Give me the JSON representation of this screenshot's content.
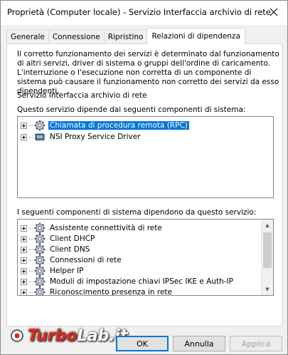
{
  "window": {
    "title": "Proprietà (Computer locale) - Servizio Interfaccia archivio di rete"
  },
  "tabs": [
    {
      "label": "Generale"
    },
    {
      "label": "Connessione"
    },
    {
      "label": "Ripristino"
    },
    {
      "label": "Relazioni di dipendenza"
    }
  ],
  "description": "Il corretto funzionamento dei servizi è determinato dal funzionamento di altri servizi, driver di sistema o gruppi dell'ordine di caricamento. L'interruzione o l'esecuzione non corretta di un componente di sistema può causare il funzionamento non corretto dei servizi da esso dipendenti.",
  "service_name": "Servizio Interfaccia archivio di rete",
  "depends_on": {
    "label": "Questo servizio dipende dai seguenti componenti di sistema:",
    "items": [
      {
        "label": "Chiamata di procedura remota (RPC)"
      },
      {
        "label": "NSI Proxy Service Driver"
      }
    ]
  },
  "dependents": {
    "label": "I seguenti componenti di sistema dipendono da questo servizio:",
    "items": [
      {
        "label": "Assistente connettività di rete"
      },
      {
        "label": "Client DHCP"
      },
      {
        "label": "Client DNS"
      },
      {
        "label": "Connessioni di rete"
      },
      {
        "label": "Helper IP"
      },
      {
        "label": "Moduli di impostazione chiavi IPSec IKE e Auth-IP"
      },
      {
        "label": "Riconoscimento presenza in rete"
      }
    ]
  },
  "buttons": {
    "ok": "OK",
    "cancel": "Annulla",
    "apply": "Applica"
  },
  "watermark": {
    "part1": "Turbo",
    "part2": "Lab.it"
  },
  "colors": {
    "selection": "#0078d7",
    "watermark_red": "#e0281e"
  }
}
